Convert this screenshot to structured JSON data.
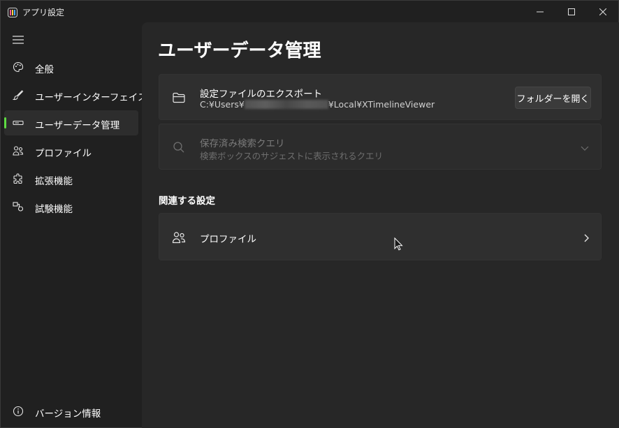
{
  "window": {
    "title": "アプリ設定",
    "icon": "app-logo-icon"
  },
  "sidebar": {
    "menu_icon": "hamburger-icon",
    "items": [
      {
        "label": "全般",
        "icon": "palette-icon",
        "selected": false
      },
      {
        "label": "ユーザーインターフェイス",
        "icon": "brush-icon",
        "selected": false
      },
      {
        "label": "ユーザーデータ管理",
        "icon": "storage-icon",
        "selected": true
      },
      {
        "label": "プロファイル",
        "icon": "profile-icon",
        "selected": false
      },
      {
        "label": "拡張機能",
        "icon": "puzzle-icon",
        "selected": false
      },
      {
        "label": "試験機能",
        "icon": "shapes-icon",
        "selected": false
      }
    ],
    "footer": {
      "label": "バージョン情報",
      "icon": "info-icon"
    }
  },
  "main": {
    "title": "ユーザーデータ管理",
    "export_card": {
      "title": "設定ファイルのエクスポート",
      "path_prefix": "C:¥Users¥",
      "path_suffix": "¥Local¥XTimelineViewer",
      "button_label": "フォルダーを開く"
    },
    "saved_queries_card": {
      "title": "保存済み検索クエリ",
      "subtitle": "検索ボックスのサジェストに表示されるクエリ",
      "enabled": false
    },
    "related_header": "関連する設定",
    "related_items": [
      {
        "label": "プロファイル",
        "icon": "profile-icon"
      }
    ]
  },
  "colors": {
    "accent": "#5edc42",
    "background": "#202020",
    "content": "#272727",
    "card": "#2f2f2f"
  }
}
